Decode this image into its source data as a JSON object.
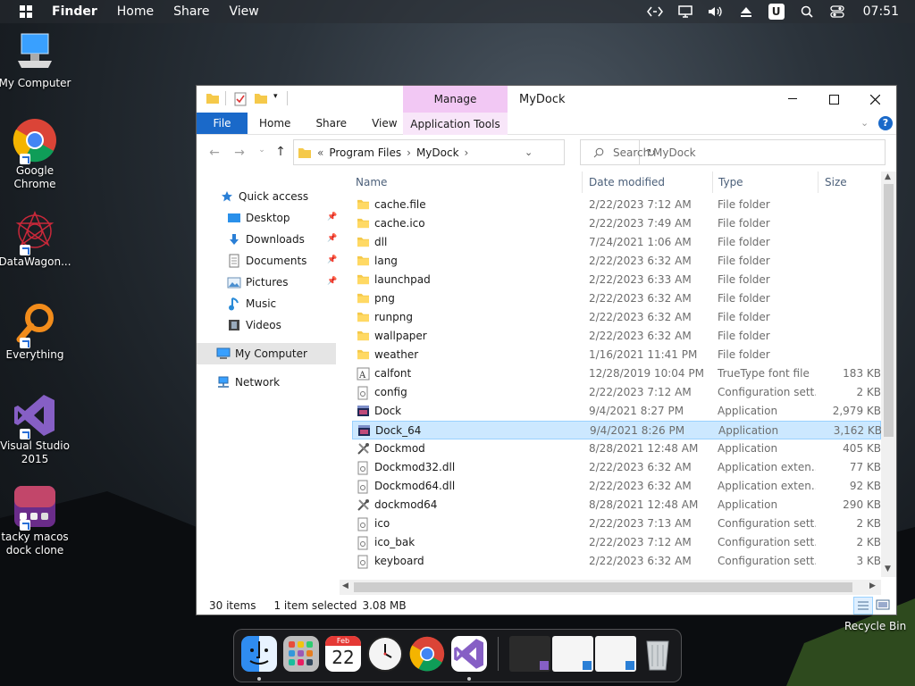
{
  "topbar": {
    "windows_logo": "windows-logo",
    "menu": [
      "Finder",
      "Home",
      "Share",
      "View"
    ],
    "clock": "07:51",
    "tray_icons": [
      "code-icon",
      "monitor-icon",
      "volume-icon",
      "eject-icon",
      "u-badge-icon",
      "search-icon",
      "control-center-icon"
    ],
    "u_badge": "U"
  },
  "desktop_icons": [
    {
      "label": "My Computer",
      "icon": "computer-icon"
    },
    {
      "label": "Google Chrome",
      "icon": "chrome-icon"
    },
    {
      "label": "DataWagon...",
      "icon": "datawagon-icon"
    },
    {
      "label": "Everything",
      "icon": "everything-search-icon"
    },
    {
      "label": "Visual Studio 2015",
      "icon": "visual-studio-icon"
    },
    {
      "label": "tacky macos dock clone",
      "icon": "dock-clone-icon"
    }
  ],
  "window": {
    "title": "MyDock",
    "manage_tab": "Manage",
    "ribbon_tabs": [
      "File",
      "Home",
      "Share",
      "View"
    ],
    "application_tools": "Application Tools",
    "address": {
      "chevron": "«",
      "parts": [
        "Program Files",
        "MyDock"
      ]
    },
    "search_placeholder": "Search MyDock",
    "columns": [
      "Name",
      "Date modified",
      "Type",
      "Size"
    ],
    "nav": {
      "quick_access": "Quick access",
      "items": [
        "Desktop",
        "Downloads",
        "Documents",
        "Pictures",
        "Music",
        "Videos"
      ],
      "my_computer": "My Computer",
      "network": "Network"
    },
    "files": [
      {
        "name": "cache.file",
        "date": "2/22/2023 7:12 AM",
        "type": "File folder",
        "size": "",
        "icon": "folder"
      },
      {
        "name": "cache.ico",
        "date": "2/22/2023 7:49 AM",
        "type": "File folder",
        "size": "",
        "icon": "folder"
      },
      {
        "name": "dll",
        "date": "7/24/2021 1:06 AM",
        "type": "File folder",
        "size": "",
        "icon": "folder"
      },
      {
        "name": "lang",
        "date": "2/22/2023 6:32 AM",
        "type": "File folder",
        "size": "",
        "icon": "folder"
      },
      {
        "name": "launchpad",
        "date": "2/22/2023 6:33 AM",
        "type": "File folder",
        "size": "",
        "icon": "folder"
      },
      {
        "name": "png",
        "date": "2/22/2023 6:32 AM",
        "type": "File folder",
        "size": "",
        "icon": "folder"
      },
      {
        "name": "runpng",
        "date": "2/22/2023 6:32 AM",
        "type": "File folder",
        "size": "",
        "icon": "folder"
      },
      {
        "name": "wallpaper",
        "date": "2/22/2023 6:32 AM",
        "type": "File folder",
        "size": "",
        "icon": "folder"
      },
      {
        "name": "weather",
        "date": "1/16/2021 11:41 PM",
        "type": "File folder",
        "size": "",
        "icon": "folder"
      },
      {
        "name": "calfont",
        "date": "12/28/2019 10:04 PM",
        "type": "TrueType font file",
        "size": "183 KB",
        "icon": "font"
      },
      {
        "name": "config",
        "date": "2/22/2023 7:12 AM",
        "type": "Configuration sett...",
        "size": "2 KB",
        "icon": "config"
      },
      {
        "name": "Dock",
        "date": "9/4/2021 8:27 PM",
        "type": "Application",
        "size": "2,979 KB",
        "icon": "app"
      },
      {
        "name": "Dock_64",
        "date": "9/4/2021 8:26 PM",
        "type": "Application",
        "size": "3,162 KB",
        "icon": "app",
        "selected": true
      },
      {
        "name": "Dockmod",
        "date": "8/28/2021 12:48 AM",
        "type": "Application",
        "size": "405 KB",
        "icon": "tool"
      },
      {
        "name": "Dockmod32.dll",
        "date": "2/22/2023 6:32 AM",
        "type": "Application exten...",
        "size": "77 KB",
        "icon": "config"
      },
      {
        "name": "Dockmod64.dll",
        "date": "2/22/2023 6:32 AM",
        "type": "Application exten...",
        "size": "92 KB",
        "icon": "config"
      },
      {
        "name": "dockmod64",
        "date": "8/28/2021 12:48 AM",
        "type": "Application",
        "size": "290 KB",
        "icon": "tool"
      },
      {
        "name": "ico",
        "date": "2/22/2023 7:13 AM",
        "type": "Configuration sett...",
        "size": "2 KB",
        "icon": "config"
      },
      {
        "name": "ico_bak",
        "date": "2/22/2023 7:12 AM",
        "type": "Configuration sett...",
        "size": "2 KB",
        "icon": "config"
      },
      {
        "name": "keyboard",
        "date": "2/22/2023 6:32 AM",
        "type": "Configuration sett...",
        "size": "3 KB",
        "icon": "config"
      }
    ],
    "status": {
      "items": "30 items",
      "selected": "1 item selected",
      "size": "3.08 MB"
    }
  },
  "dock": {
    "items": [
      "finder-icon",
      "launchpad-icon",
      "calendar-icon",
      "clock-icon",
      "chrome-icon",
      "visual-studio-icon",
      "window-thumbnail-1",
      "window-thumbnail-2",
      "window-thumbnail-3",
      "trash-icon"
    ],
    "calendar": {
      "month": "Feb",
      "day": "22"
    }
  },
  "recycle_bin": "Recycle Bin",
  "colors": {
    "accent": "#1a69c9",
    "selection": "#cce8ff",
    "manage_tab": "#f2c8f4",
    "folder": "#f5c94a"
  }
}
